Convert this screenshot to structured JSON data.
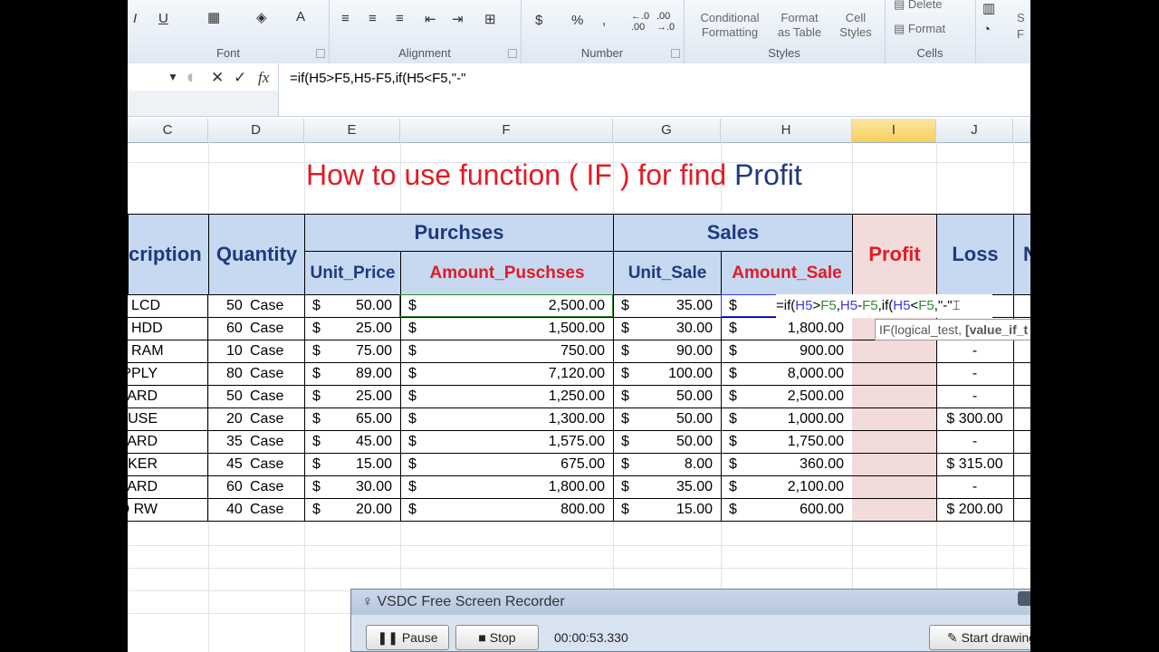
{
  "ribbon": {
    "font_group_label": "Font",
    "alignment_group_label": "Alignment",
    "number_group_label": "Number",
    "styles_group_label": "Styles",
    "cells_group_label": "Cells",
    "italic": "I",
    "underline": "U",
    "font_color_glyph": "A",
    "currency": "$",
    "percent": "%",
    "comma": ",",
    "conditional_formatting_1": "Conditional",
    "conditional_formatting_2": "Formatting",
    "format_as_table_1": "Format",
    "format_as_table_2": "as Table",
    "cell_styles_1": "Cell",
    "cell_styles_2": "Styles",
    "delete_label": "Delete",
    "format_label": "Format",
    "partial_s": "S",
    "partial_f": "F"
  },
  "formula_bar": {
    "cancel": "✕",
    "enter": "✓",
    "fx": "fx",
    "formula": "=if(H5>F5,H5-F5,if(H5<F5,\"-\""
  },
  "columns": [
    "C",
    "D",
    "E",
    "F",
    "G",
    "H",
    "I",
    "J"
  ],
  "title": {
    "part1": "How to use function ( IF ) for find",
    "part2": " Profit"
  },
  "headers": {
    "description": "cription",
    "quantity": "Quantity",
    "purchases": "Purchses",
    "sales": "Sales",
    "profit": "Profit",
    "loss": "Loss",
    "partial_n": "N",
    "unit_price": "Unit_Price",
    "amount_purchases": "Amount_Puschses",
    "unit_sale": "Unit_Sale",
    "amount_sale": "Amount_Sale"
  },
  "rows": [
    {
      "desc": "LCD",
      "qty": "50",
      "unit": "Case",
      "unit_price": "50.00",
      "amount_purchases": "2,500.00",
      "unit_sale": "35.00",
      "amount_sale": "",
      "loss": ""
    },
    {
      "desc": "HDD",
      "qty": "60",
      "unit": "Case",
      "unit_price": "25.00",
      "amount_purchases": "1,500.00",
      "unit_sale": "30.00",
      "amount_sale": "1,800.00",
      "loss": ""
    },
    {
      "desc": "RAM",
      "qty": "10",
      "unit": "Case",
      "unit_price": "75.00",
      "amount_purchases": "750.00",
      "unit_sale": "90.00",
      "amount_sale": "900.00",
      "loss": "-"
    },
    {
      "desc": "ER SUPPLY",
      "qty": "80",
      "unit": "Case",
      "unit_price": "89.00",
      "amount_purchases": "7,120.00",
      "unit_sale": "100.00",
      "amount_sale": "8,000.00",
      "loss": "-"
    },
    {
      "desc": "VORK CARD",
      "qty": "50",
      "unit": "Case",
      "unit_price": "25.00",
      "amount_purchases": "1,250.00",
      "unit_sale": "50.00",
      "amount_sale": "2,500.00",
      "loss": "-"
    },
    {
      "desc": "MOUSE",
      "qty": "20",
      "unit": "Case",
      "unit_price": "65.00",
      "amount_purchases": "1,300.00",
      "unit_sale": "50.00",
      "amount_sale": "1,000.00",
      "loss": "$ 300.00"
    },
    {
      "desc": "N BOARD",
      "qty": "35",
      "unit": "Case",
      "unit_price": "45.00",
      "amount_purchases": "1,575.00",
      "unit_sale": "50.00",
      "amount_sale": "1,750.00",
      "loss": "-"
    },
    {
      "desc": "PEAKER",
      "qty": "45",
      "unit": "Case",
      "unit_price": "15.00",
      "amount_purchases": "675.00",
      "unit_sale": "8.00",
      "amount_sale": "360.00",
      "loss": "$ 315.00"
    },
    {
      "desc": "Y BOARD",
      "qty": "60",
      "unit": "Case",
      "unit_price": "30.00",
      "amount_purchases": "1,800.00",
      "unit_sale": "35.00",
      "amount_sale": "2,100.00",
      "loss": "-"
    },
    {
      "desc": "VD RW",
      "qty": "40",
      "unit": "Case",
      "unit_price": "20.00",
      "amount_purchases": "800.00",
      "unit_sale": "15.00",
      "amount_sale": "600.00",
      "loss": "$ 200.00"
    }
  ],
  "currency_symbol": "$",
  "in_cell_edit": {
    "p1": "=if(",
    "p2": "H5",
    "p3": ">",
    "p4": "F5",
    "p5": ",",
    "p6": "H5",
    "p7": "-",
    "p8": "F5",
    "p9": ",if(",
    "p10": "H5",
    "p11": "<",
    "p12": "F5",
    "p13": ",\"-\""
  },
  "tooltip": {
    "normal": "IF(logical_test, ",
    "bold": "[value_if_t"
  },
  "recorder": {
    "title": "VSDC Free Screen Recorder",
    "pause": "Pause",
    "stop": "Stop",
    "timer": "00:00:53.330",
    "start_drawing": "Start drawing"
  }
}
